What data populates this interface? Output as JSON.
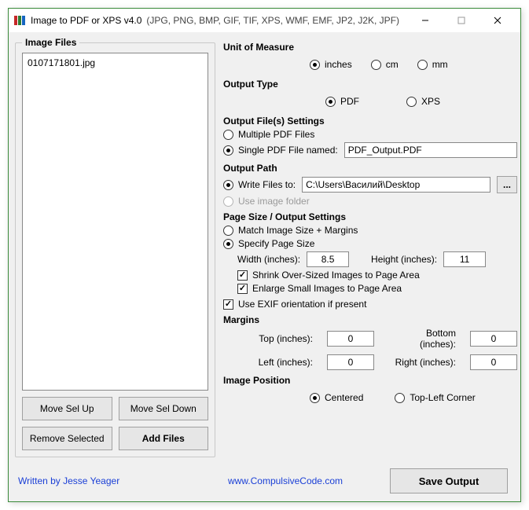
{
  "window": {
    "title": "Image to PDF or XPS  v4.0",
    "subtitle": "(JPG, PNG, BMP, GIF, TIF, XPS, WMF, EMF, JP2, J2K, JPF)"
  },
  "left": {
    "group_title": "Image Files",
    "items": [
      "0107171801.jpg"
    ],
    "move_up": "Move Sel Up",
    "move_down": "Move Sel Down",
    "remove": "Remove Selected",
    "add": "Add Files"
  },
  "unit": {
    "title": "Unit of Measure",
    "inches": "inches",
    "cm": "cm",
    "mm": "mm",
    "selected": "inches"
  },
  "output_type": {
    "title": "Output Type",
    "pdf": "PDF",
    "xps": "XPS",
    "selected": "PDF"
  },
  "output_files": {
    "title": "Output File(s) Settings",
    "multiple": "Multiple PDF Files",
    "single": "Single PDF File named:",
    "selected": "single",
    "filename": "PDF_Output.PDF"
  },
  "output_path": {
    "title": "Output Path",
    "write": "Write Files to:",
    "use_image_folder": "Use image folder",
    "selected": "write",
    "path": "C:\\Users\\Василий\\Desktop",
    "browse": "..."
  },
  "page_size": {
    "title": "Page Size / Output Settings",
    "match": "Match Image Size + Margins",
    "specify": "Specify Page Size",
    "selected": "specify",
    "width_label": "Width (inches):",
    "width": "8.5",
    "height_label": "Height (inches):",
    "height": "11",
    "shrink": "Shrink Over-Sized Images to Page Area",
    "enlarge": "Enlarge Small Images to Page Area",
    "shrink_checked": true,
    "enlarge_checked": true,
    "exif": "Use EXIF orientation if present",
    "exif_checked": true
  },
  "margins": {
    "title": "Margins",
    "top_label": "Top (inches):",
    "top": "0",
    "bottom_label": "Bottom (inches):",
    "bottom": "0",
    "left_label": "Left (inches):",
    "left": "0",
    "right_label": "Right (inches):",
    "right": "0"
  },
  "image_position": {
    "title": "Image Position",
    "centered": "Centered",
    "topleft": "Top-Left Corner",
    "selected": "centered"
  },
  "footer": {
    "written_by": "Written by Jesse Yeager",
    "site": "www.CompulsiveCode.com",
    "save": "Save Output"
  }
}
